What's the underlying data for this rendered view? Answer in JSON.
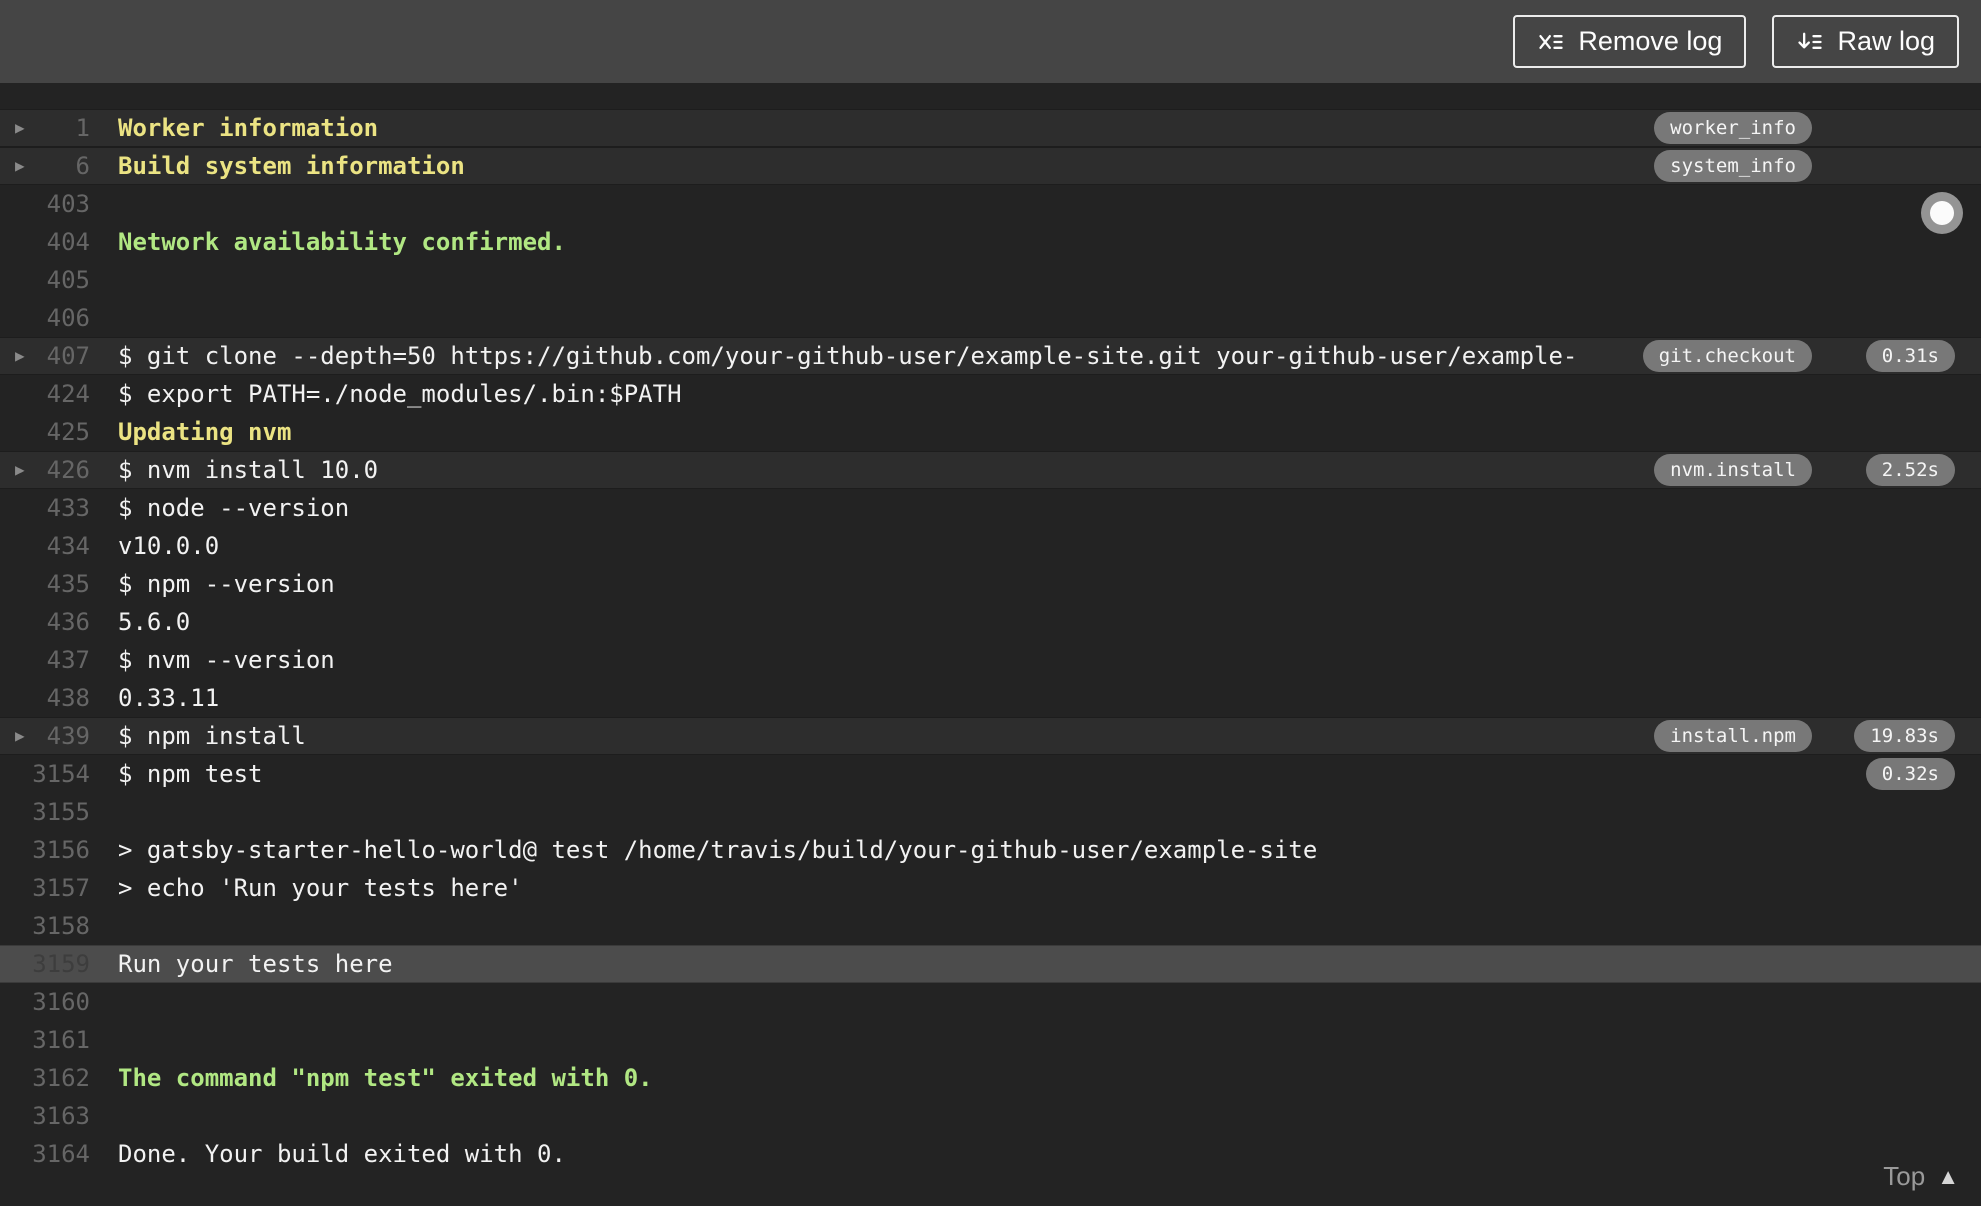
{
  "toolbar": {
    "remove_log_label": "Remove log",
    "raw_log_label": "Raw log",
    "icons": {
      "remove_log": "clear-list-icon",
      "raw_log": "download-list-icon"
    }
  },
  "log": {
    "rows": [
      {
        "num": "1",
        "text": "Worker information",
        "style": "header",
        "row_bg": "fold",
        "arrow": true,
        "tag": "worker_info"
      },
      {
        "num": "6",
        "text": "Build system information",
        "style": "header",
        "row_bg": "fold",
        "arrow": true,
        "tag": "system_info"
      },
      {
        "num": "403",
        "text": ""
      },
      {
        "num": "404",
        "text": "Network availability confirmed.",
        "style": "success"
      },
      {
        "num": "405",
        "text": ""
      },
      {
        "num": "406",
        "text": ""
      },
      {
        "num": "407",
        "text": "$ git clone --depth=50 https://github.com/your-github-user/example-site.git your-github-user/example-",
        "row_bg": "fold",
        "arrow": true,
        "tag": "git.checkout",
        "time": "0.31s"
      },
      {
        "num": "424",
        "text": "$ export PATH=./node_modules/.bin:$PATH"
      },
      {
        "num": "425",
        "text": "Updating nvm",
        "style": "header"
      },
      {
        "num": "426",
        "text": "$ nvm install 10.0",
        "row_bg": "fold",
        "arrow": true,
        "tag": "nvm.install",
        "time": "2.52s"
      },
      {
        "num": "433",
        "text": "$ node --version"
      },
      {
        "num": "434",
        "text": "v10.0.0"
      },
      {
        "num": "435",
        "text": "$ npm --version"
      },
      {
        "num": "436",
        "text": "5.6.0"
      },
      {
        "num": "437",
        "text": "$ nvm --version"
      },
      {
        "num": "438",
        "text": "0.33.11"
      },
      {
        "num": "439",
        "text": "$ npm install",
        "row_bg": "fold",
        "arrow": true,
        "tag": "install.npm",
        "time": "19.83s"
      },
      {
        "num": "3154",
        "text": "$ npm test",
        "time": "0.32s"
      },
      {
        "num": "3155",
        "text": ""
      },
      {
        "num": "3156",
        "text": "> gatsby-starter-hello-world@ test /home/travis/build/your-github-user/example-site"
      },
      {
        "num": "3157",
        "text": "> echo 'Run your tests here'"
      },
      {
        "num": "3158",
        "text": ""
      },
      {
        "num": "3159",
        "text": "Run your tests here",
        "row_bg": "selected"
      },
      {
        "num": "3160",
        "text": ""
      },
      {
        "num": "3161",
        "text": ""
      },
      {
        "num": "3162",
        "text": "The command \"npm test\" exited with 0.",
        "style": "success"
      },
      {
        "num": "3163",
        "text": ""
      },
      {
        "num": "3164",
        "text": "Done. Your build exited with 0."
      }
    ],
    "top_link": {
      "label": "Top",
      "icon": "triangle-up-icon",
      "glyph": "▲"
    },
    "fold_arrow_glyph": "▶"
  },
  "colors": {
    "topbar_bg": "#454545",
    "log_bg": "#232323",
    "fold_row_bg": "#2d2d2d",
    "selected_row_bg": "#4c4c4c",
    "header_yellow": "#ebe383",
    "success_green": "#b1e783",
    "badge_bg": "#787878",
    "line_number_gray": "#666666"
  }
}
